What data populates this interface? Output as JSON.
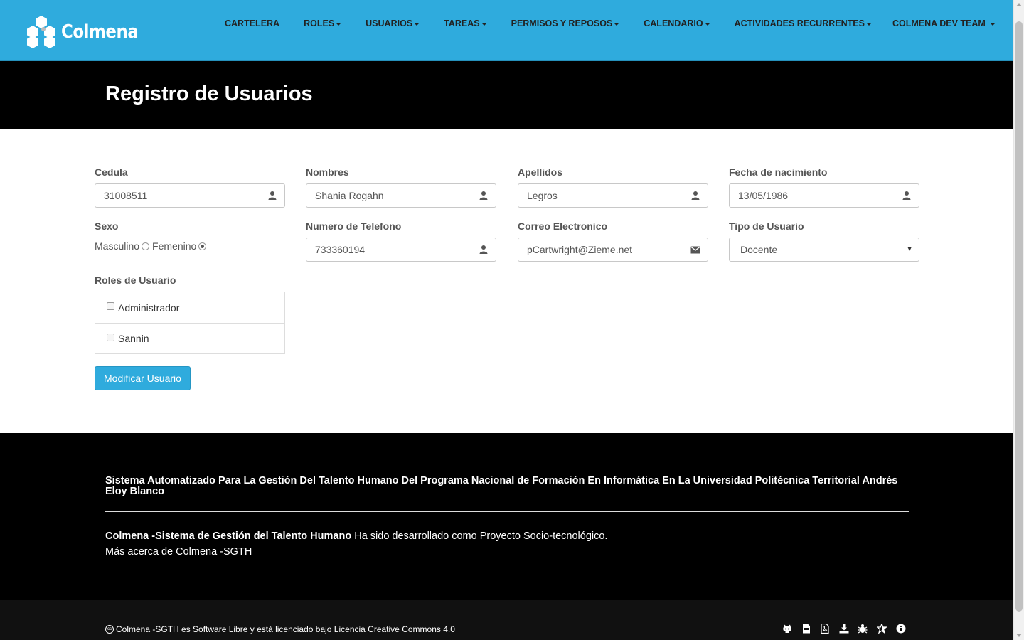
{
  "app": {
    "brand": "Colmena"
  },
  "nav": {
    "items": [
      {
        "label": "CARTELERA",
        "dropdown": false
      },
      {
        "label": "ROLES",
        "dropdown": true
      },
      {
        "label": "USUARIOS",
        "dropdown": true
      },
      {
        "label": "TAREAS",
        "dropdown": true
      },
      {
        "label": "PERMISOS Y REPOSOS",
        "dropdown": true
      },
      {
        "label": "CALENDARIO",
        "dropdown": true
      },
      {
        "label": "ACTIVIDADES RECURRENTES",
        "dropdown": true
      }
    ],
    "user_menu": "COLMENA DEV TEAM"
  },
  "header": {
    "title": "Registro de Usuarios"
  },
  "form": {
    "cedula": {
      "label": "Cedula",
      "value": "31008511",
      "icon": "user-icon"
    },
    "nombres": {
      "label": "Nombres",
      "value": "Shania Rogahn",
      "icon": "user-icon"
    },
    "apellidos": {
      "label": "Apellidos",
      "value": "Legros",
      "icon": "user-icon"
    },
    "fecha": {
      "label": "Fecha de nacimiento",
      "value": "13/05/1986",
      "icon": "user-icon"
    },
    "sexo": {
      "label": "Sexo",
      "options": [
        "Masculino",
        "Femenino"
      ],
      "selected": "Femenino"
    },
    "telefono": {
      "label": "Numero de Telefono",
      "value": "733360194",
      "icon": "user-icon"
    },
    "correo": {
      "label": "Correo Electronico",
      "value": "pCartwright@Zieme.net",
      "icon": "envelope-icon"
    },
    "tipo": {
      "label": "Tipo de Usuario",
      "selected": "Docente"
    },
    "roles": {
      "label": "Roles de Usuario",
      "items": [
        {
          "label": "Administrador",
          "checked": false
        },
        {
          "label": "Sannin",
          "checked": false
        }
      ]
    },
    "submit_label": "Modificar Usuario"
  },
  "footer": {
    "title": "Sistema Automatizado Para La Gestión Del Talento Humano Del Programa Nacional de Formación En Informática En La Universidad Politécnica Territorial Andrés Eloy Blanco",
    "desc_bold": "Colmena -Sistema de Gestión del Talento Humano",
    "desc_rest": " Ha sido desarrollado como Proyecto Socio-tecnológico.",
    "more": "Más acerca de Colmena -SGTH",
    "copyright": "Colmena -SGTH es Software Libre y está licenciado bajo Licencia Creative Commons 4.0",
    "cc_icon": "creative-commons-icon",
    "icons": [
      "github-icon",
      "document-icon",
      "pdf-icon",
      "download-icon",
      "bug-icon",
      "star-icon",
      "info-icon"
    ]
  },
  "colors": {
    "navbar": "#2fabdd",
    "header_bg": "#000000",
    "footer_bg": "#000000",
    "bottom_bar_bg": "#111111",
    "button": "#2fabdd"
  }
}
